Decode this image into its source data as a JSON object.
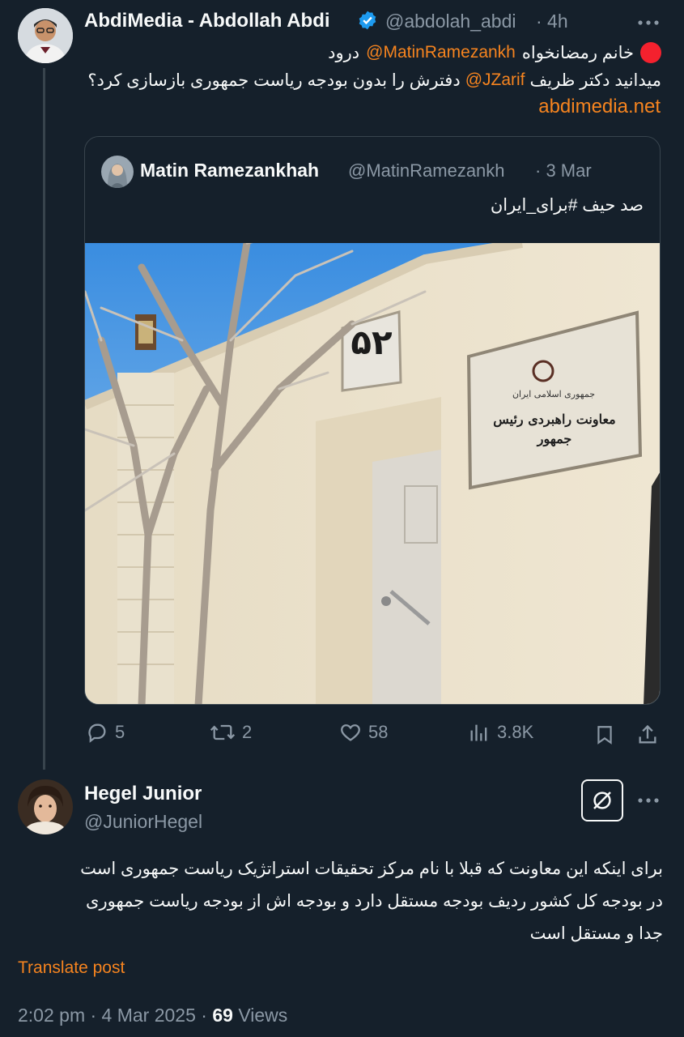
{
  "post": {
    "author_name": "AbdiMedia - Abdollah Abdi",
    "author_handle": "@abdolah_abdi",
    "time_ago": "· 4h",
    "line1_greeting": "درود",
    "line1_mention": "@MatinRamezankh",
    "line1_rest": "خانم رمضانخواه",
    "line2_start": "میدانید دکتر ظریف",
    "line2_mention": "@JZarif",
    "line2_rest": "دفترش را بدون بودجه ریاست جمهوری بازسازی کرد؟",
    "link": "abdimedia.net",
    "more_icon": "more-horizontal-icon",
    "verified_color": "#1d9bf0",
    "status_dot_color": "#f4212e"
  },
  "quote": {
    "author_name": "Matin Ramezankhah",
    "author_handle": "@MatinRamezankh",
    "date": "· 3 Mar",
    "text": "صد حیف #برای_ایران"
  },
  "photo": {
    "house_number": "۵۲",
    "sign_line1": "جمهوری اسلامی ایران",
    "sign_line2": "معاونت راهبردی رئیس جمهور"
  },
  "actions": {
    "replies": "5",
    "reposts": "2",
    "likes": "58",
    "views": "3.8K"
  },
  "reply": {
    "author_name": "Hegel Junior",
    "author_handle": "@JuniorHegel",
    "text_line1": "برای اینکه این معاونت که قبلا با نام مرکز تحقیقات استراتژیک ریاست جمهوری است",
    "text_line2": "در بودجه کل کشور ردیف بودجه مستقل دارد و بودجه اش از بودجه ریاست جمهوری",
    "text_line3": "جدا و مستقل است",
    "translate": "Translate post",
    "timestamp": "2:02 pm · 4 Mar 2025 ·",
    "views_count": "69",
    "views_label": "Views"
  },
  "accent_color": "#f6841f"
}
